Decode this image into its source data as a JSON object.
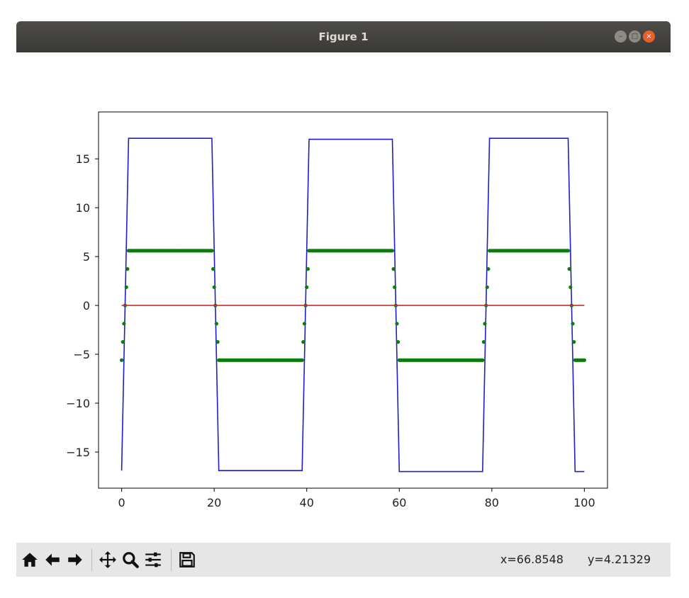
{
  "window": {
    "title": "Figure 1"
  },
  "toolbar": {
    "buttons": [
      "home-icon",
      "back-arrow-icon",
      "forward-arrow-icon",
      "pan-icon",
      "zoom-icon",
      "configure-subplots-icon",
      "save-icon"
    ],
    "coord_x": "x=66.8548",
    "coord_y": "y=4.21329"
  },
  "colors": {
    "blue": "#1f1fc8",
    "green": "#0a7d0a",
    "red": "#d62728",
    "titlebar": "#3c3b37",
    "close": "#e9602c"
  },
  "chart_data": {
    "type": "line",
    "xlim": [
      -5,
      105
    ],
    "ylim": [
      -18.7,
      19.8
    ],
    "xticks": [
      0,
      20,
      40,
      60,
      80,
      100
    ],
    "xtick_labels": [
      "0",
      "20",
      "40",
      "60",
      "80",
      "100"
    ],
    "yticks": [
      -15,
      -10,
      -5,
      0,
      5,
      10,
      15
    ],
    "ytick_labels": [
      "−15",
      "−10",
      "−5",
      "0",
      "5",
      "10",
      "15"
    ],
    "grid": false,
    "series": [
      {
        "style": "line",
        "color": "#1f1fc8",
        "x": [
          0,
          1.5,
          19.5,
          21,
          39,
          40.5,
          58.5,
          60,
          78,
          79.5,
          96.5,
          98,
          100
        ],
        "y": [
          -16.9,
          17.1,
          17.1,
          -16.9,
          -16.9,
          17.0,
          17.0,
          -17.0,
          -17.0,
          17.1,
          17.1,
          -17.0,
          -17.0
        ]
      },
      {
        "style": "scatter",
        "color": "#0a7d0a",
        "x": [
          0,
          1.5,
          19.5,
          21,
          39,
          40.5,
          58.5,
          60,
          78,
          79.5,
          96.5,
          98,
          100
        ],
        "y": [
          -5.6,
          5.6,
          5.6,
          -5.6,
          -5.6,
          5.6,
          5.6,
          -5.6,
          -5.6,
          5.6,
          5.6,
          -5.6,
          -5.6
        ]
      },
      {
        "style": "line",
        "color": "#d62728",
        "x": [
          0,
          100
        ],
        "y": [
          0,
          0
        ]
      }
    ]
  }
}
